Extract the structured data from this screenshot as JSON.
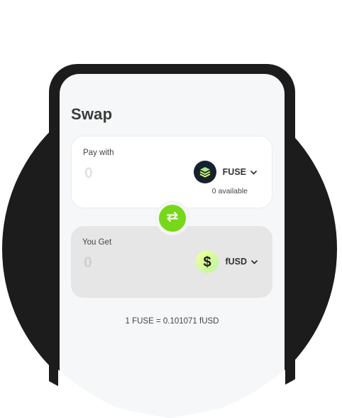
{
  "swap": {
    "title": "Swap",
    "pay": {
      "label": "Pay with",
      "amount": "0",
      "token": "FUSE",
      "token_icon": "fuse-logo-icon",
      "available": "0 available"
    },
    "get": {
      "label": "You Get",
      "amount": "0",
      "token": "fUSD",
      "token_icon": "dollar-sign-icon"
    },
    "switch_icon": "swap-arrows-icon",
    "rate": "1 FUSE = 0.101071 fUSD"
  },
  "colors": {
    "accent_green": "#75d918",
    "dark": "#1c1c1c",
    "screen_bg": "#f6f7f8"
  }
}
